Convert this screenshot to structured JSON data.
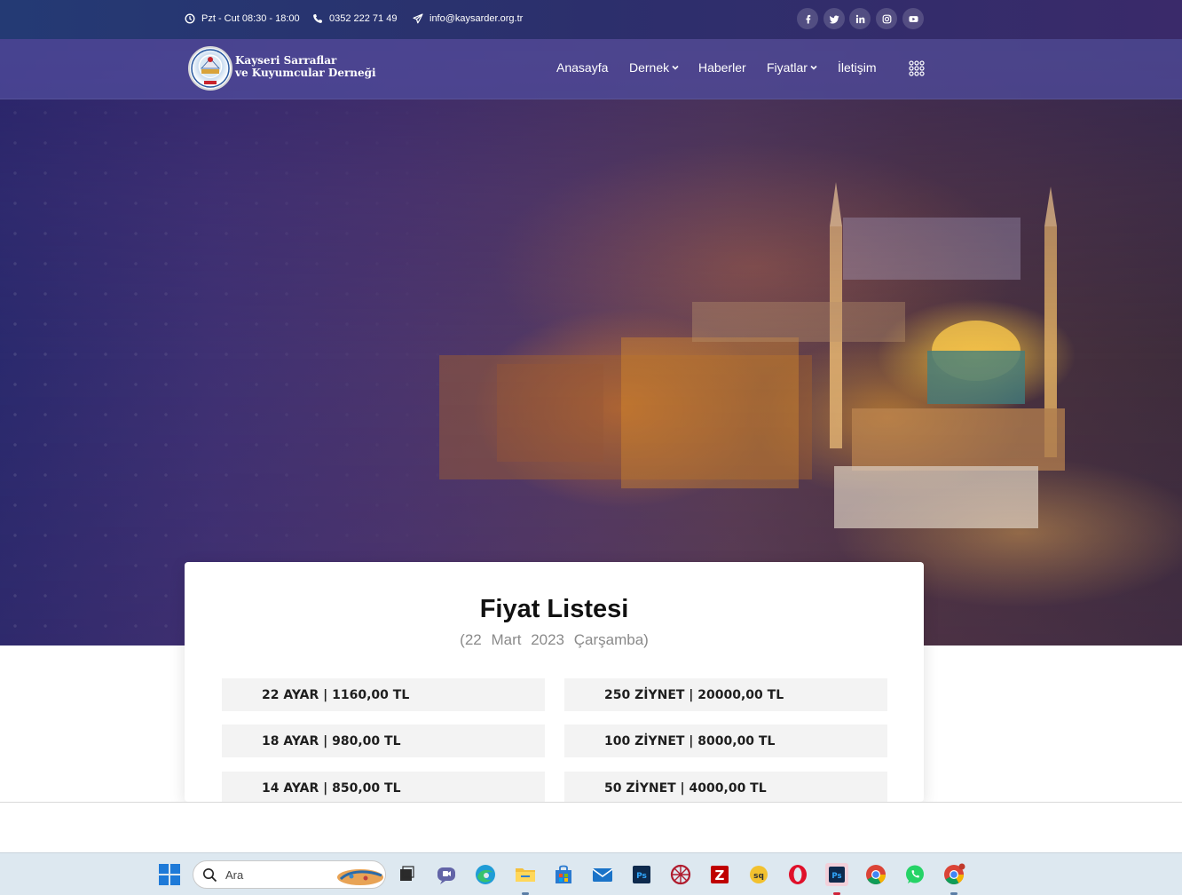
{
  "topbar": {
    "hours": "Pzt - Cut 08:30 - 18:00",
    "phone": "0352 222 71 49",
    "email": "info@kaysarder.org.tr",
    "social": [
      "facebook-icon",
      "twitter-icon",
      "linkedin-icon",
      "instagram-icon",
      "youtube-icon"
    ]
  },
  "logo": {
    "line1": "Kayseri Sarraflar",
    "line2": "ve Kuyumcular Derneği"
  },
  "nav": {
    "items": [
      {
        "label": "Anasayfa"
      },
      {
        "label": "Dernek"
      },
      {
        "label": "Haberler"
      },
      {
        "label": "Fiyatlar"
      },
      {
        "label": "İletişim"
      }
    ]
  },
  "prices": {
    "title": "Fiyat Listesi",
    "date": "(22 Mart 2023 Çarşamba)",
    "left": [
      "22 AYAR | 1160,00 TL",
      "18 AYAR | 980,00 TL",
      "14 AYAR | 850,00 TL"
    ],
    "right": [
      "250 ZİYNET | 20000,00 TL",
      "100 ZİYNET | 8000,00 TL",
      "50 ZİYNET | 4000,00 TL"
    ]
  },
  "taskbar": {
    "search_placeholder": "Ara",
    "apps": [
      "windows-start-icon",
      "task-view-icon",
      "teams-icon",
      "edge-icon",
      "file-explorer-icon",
      "store-icon",
      "mail-icon",
      "photoshop-icon",
      "network-app-icon",
      "filezilla-icon",
      "sq-app-icon",
      "opera-icon",
      "photoshop-active-icon",
      "chrome-icon",
      "whatsapp-icon",
      "chrome-profile-icon"
    ]
  }
}
